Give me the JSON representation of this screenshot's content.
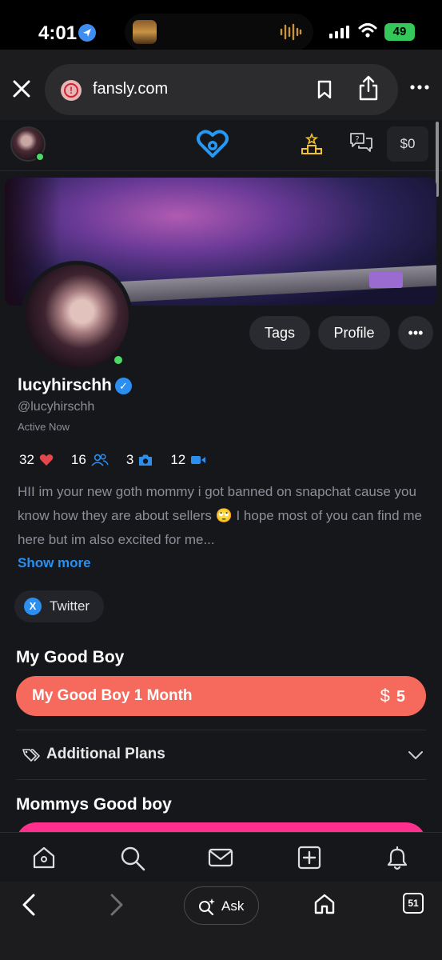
{
  "status_bar": {
    "time": "4:01",
    "battery": "49"
  },
  "browser": {
    "url": "fansly.com",
    "ask_label": "Ask",
    "tab_count": "51"
  },
  "nav": {
    "balance": "$0"
  },
  "profile": {
    "username": "lucyhirschh",
    "handle": "@lucyhirschh",
    "status": "Active Now",
    "buttons": {
      "tags": "Tags",
      "profile": "Profile",
      "more": "•••"
    },
    "stats": {
      "likes": "32",
      "followers": "16",
      "photos": "3",
      "videos": "12"
    },
    "bio": "HII im your new goth mommy i got banned on snapchat cause you know how they are about sellers 🙄 I hope most of you can find me here but im also excited for me...",
    "show_more": "Show more",
    "social_link": "Twitter",
    "twitter_glyph": "X"
  },
  "subscriptions": {
    "tier1_title": "My Good Boy",
    "tier1_button": "My Good Boy 1 Month",
    "tier1_currency": "$",
    "tier1_price": "5",
    "additional_plans": "Additional Plans",
    "tier2_title": "Mommys Good boy"
  },
  "colors": {
    "accent_blue": "#2b8ff0",
    "tier1_button": "#f56a5c",
    "tier2_button": "#ff2f8e",
    "online": "#4cd964",
    "background": "#16171a"
  },
  "icons": {
    "tabbar": [
      "home-icon",
      "search-icon",
      "messages-icon",
      "create-post-icon",
      "notifications-icon"
    ]
  }
}
